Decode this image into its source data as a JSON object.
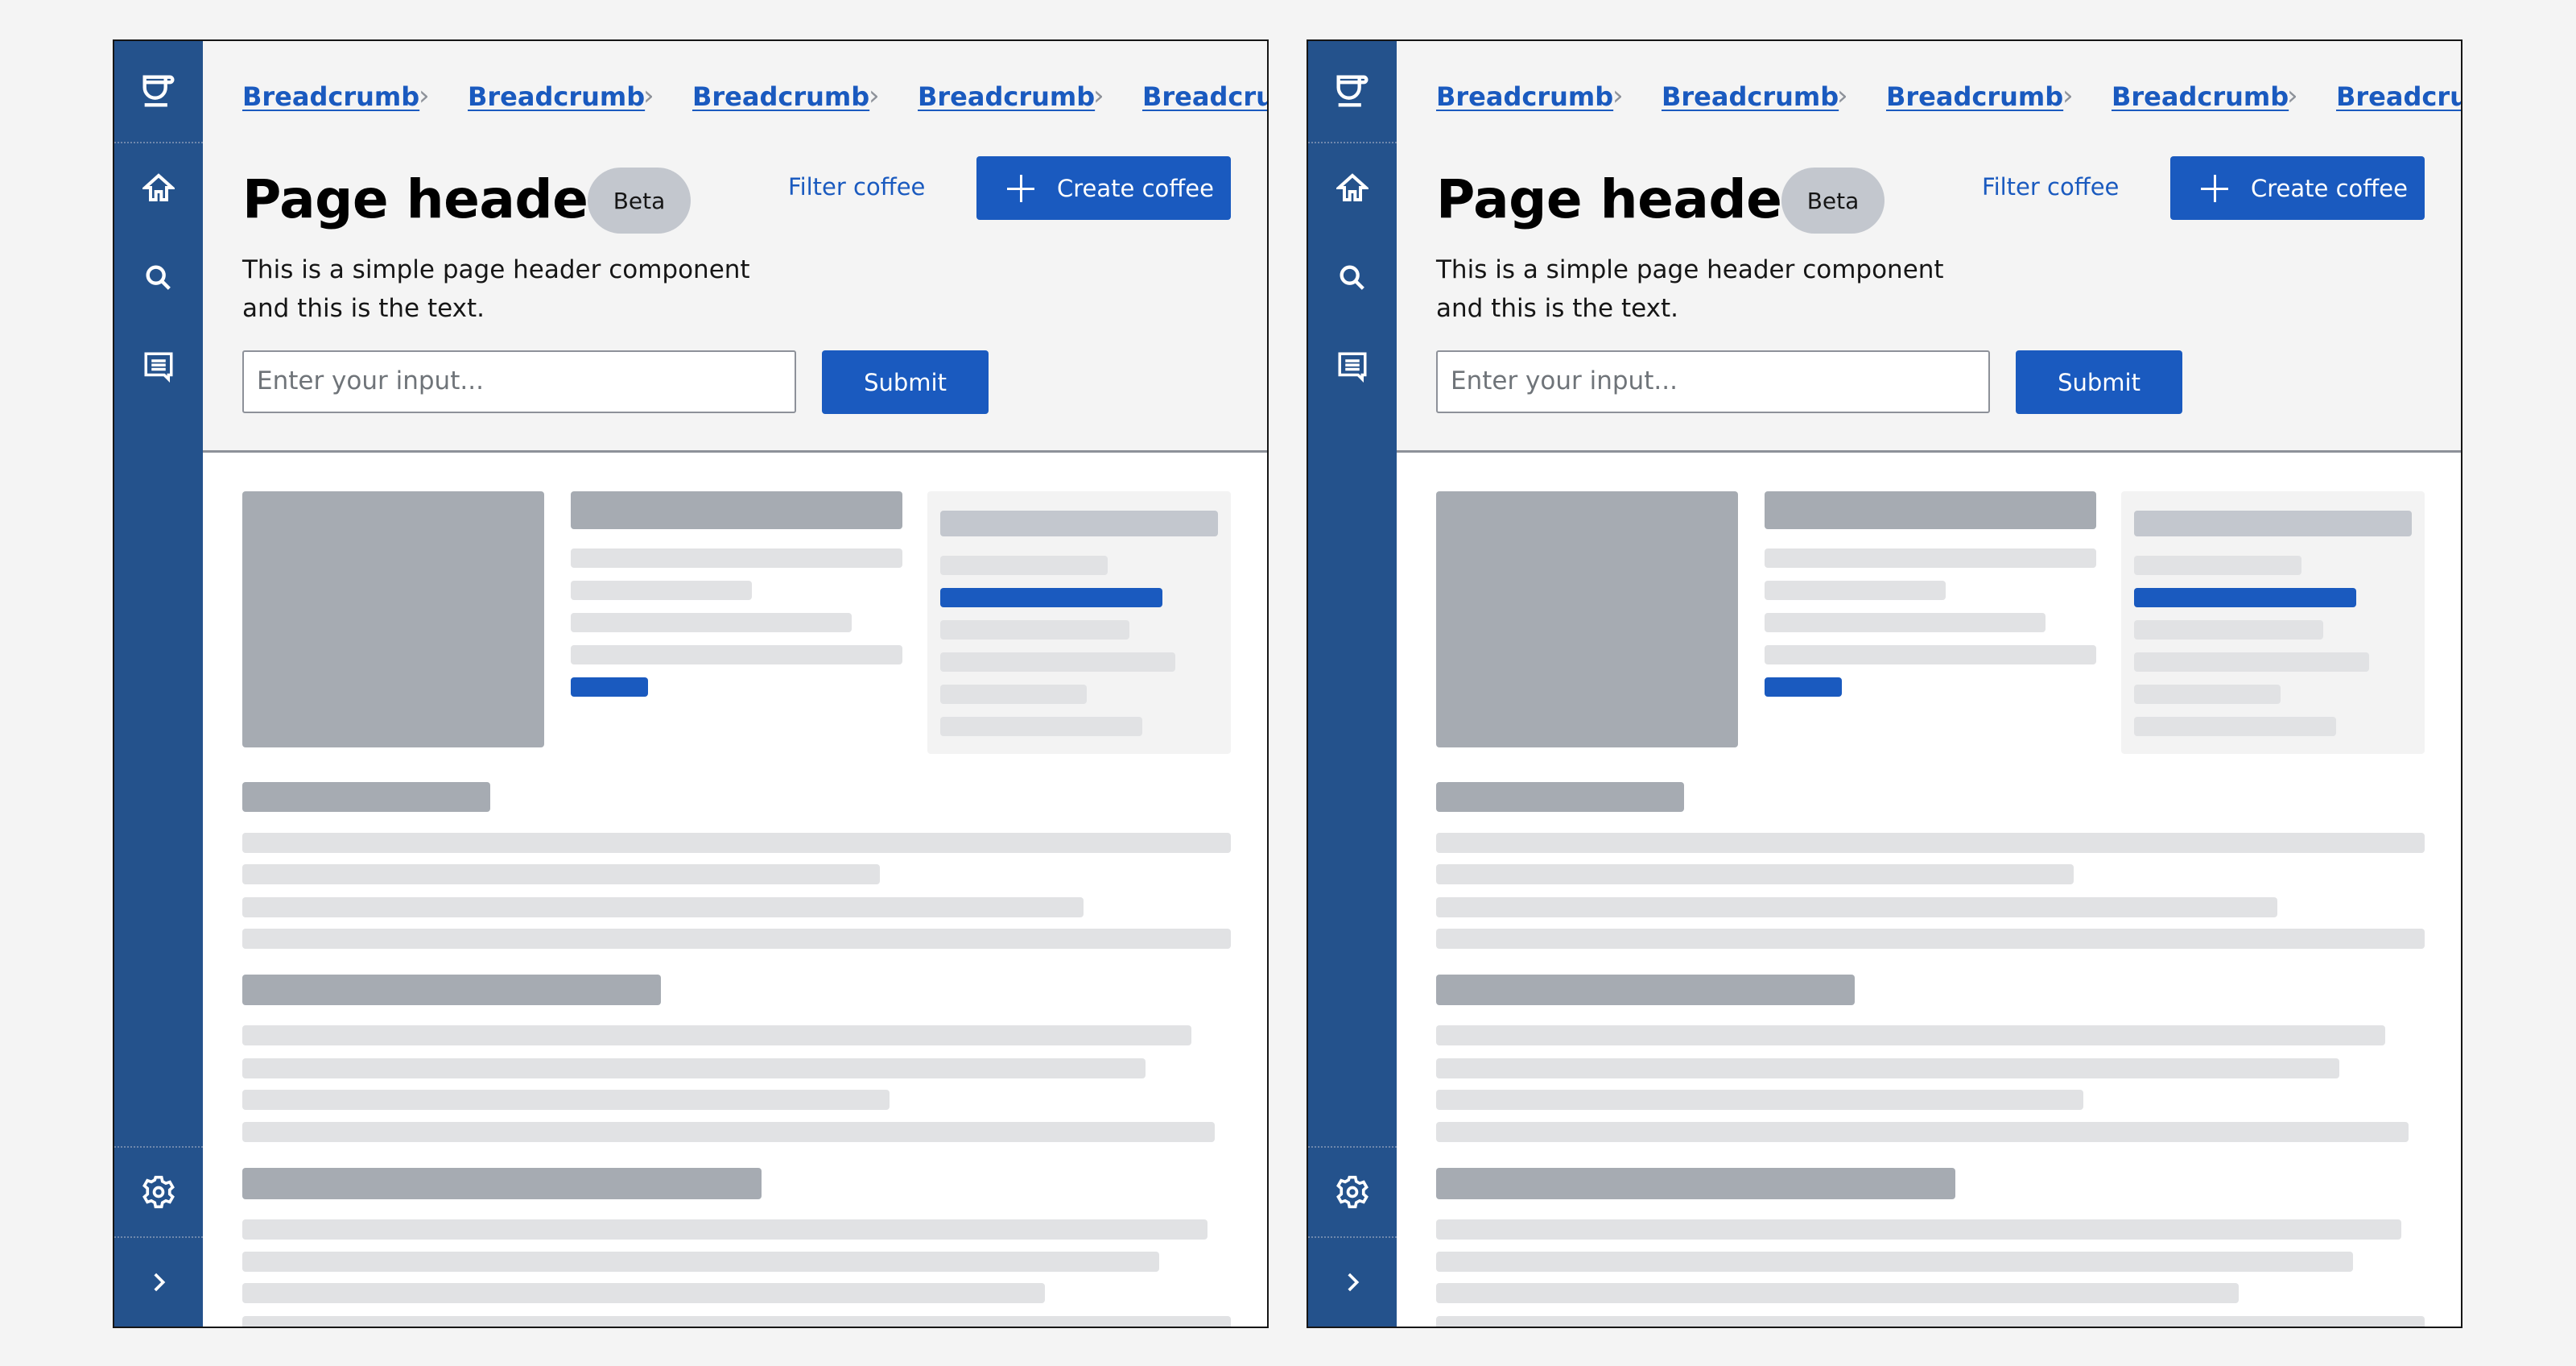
{
  "frames": [
    {
      "sidebar": {
        "logo_icon": "coffee-cup-icon",
        "items": [
          {
            "icon": "home-icon",
            "label": "Home"
          },
          {
            "icon": "search-icon",
            "label": "Search"
          },
          {
            "icon": "chat-icon",
            "label": "Messages"
          }
        ],
        "bottom_items": [
          {
            "icon": "gear-icon",
            "label": "Settings"
          },
          {
            "icon": "chevron-right-icon",
            "label": "Expand"
          }
        ]
      },
      "header": {
        "breadcrumbs": [
          "Breadcrumb",
          "Breadcrumb",
          "Breadcrumb",
          "Breadcrumb",
          "Breadcrumb"
        ],
        "breadcrumb_separator": "›",
        "title": "Page header",
        "badge": "Beta",
        "filter_link": "Filter coffee",
        "create_button": "Create coffee",
        "description_line1": "This is a simple page header component",
        "description_line2": "and this is the text.",
        "input_placeholder": "Enter your input...",
        "input_value": "",
        "submit_button": "Submit"
      }
    },
    {
      "sidebar": {
        "logo_icon": "coffee-cup-icon",
        "items": [
          {
            "icon": "home-icon",
            "label": "Home"
          },
          {
            "icon": "search-icon",
            "label": "Search"
          },
          {
            "icon": "chat-icon",
            "label": "Messages"
          }
        ],
        "bottom_items": [
          {
            "icon": "gear-icon",
            "label": "Settings"
          },
          {
            "icon": "chevron-right-icon",
            "label": "Expand"
          }
        ]
      },
      "header": {
        "breadcrumbs": [
          "Breadcrumb",
          "Breadcrumb",
          "Breadcrumb",
          "Breadcrumb",
          "Breadcrumb"
        ],
        "breadcrumb_separator": "›",
        "title": "Page header",
        "badge": "Beta",
        "filter_link": "Filter coffee",
        "create_button": "Create coffee",
        "description_line1": "This is a simple page header component",
        "description_line2": "and this is the text.",
        "input_placeholder": "Enter your input...",
        "input_value": "",
        "submit_button": "Submit"
      }
    }
  ],
  "colors": {
    "sidebar": "#24528c",
    "primary": "#1a5abf",
    "header_bg": "#f4f4f4",
    "skeleton_dark": "#a6abb2",
    "skeleton_light": "#e1e2e4",
    "badge_bg": "#c3c7ce"
  }
}
